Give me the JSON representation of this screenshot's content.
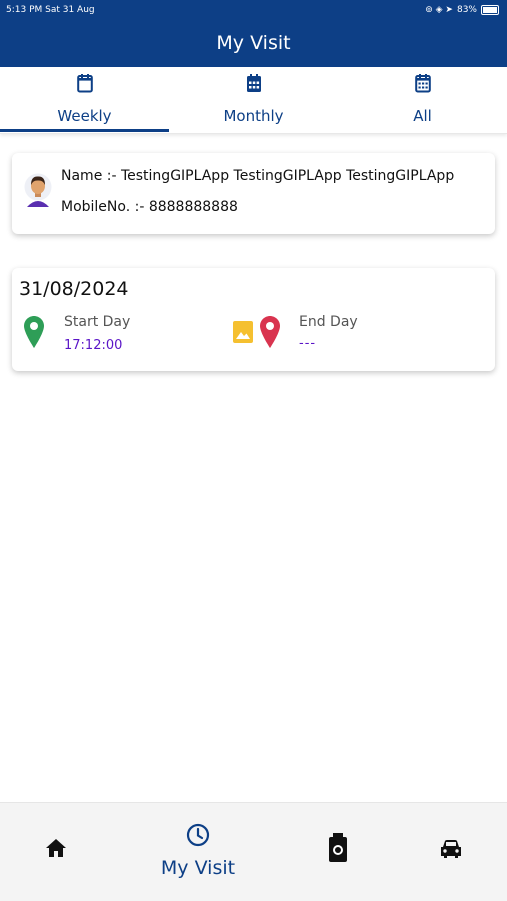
{
  "status_bar": {
    "time_date": "5:13 PM   Sat 31 Aug",
    "battery": "83%"
  },
  "header": {
    "title": "My Visit"
  },
  "tabs": [
    {
      "label": "Weekly",
      "icon": "calendar-icon",
      "selected": true
    },
    {
      "label": "Monthly",
      "icon": "calendar-month-icon",
      "selected": false
    },
    {
      "label": "All",
      "icon": "calendar-all-icon",
      "selected": false
    }
  ],
  "user": {
    "name_line": "Name :- TestingGIPLApp TestingGIPLApp TestingGIPLApp",
    "mobile_line": "MobileNo. :- 8888888888"
  },
  "visit": {
    "date": "31/08/2024",
    "start_label": "Start Day",
    "start_time": "17:12:00",
    "end_label": "End Day",
    "end_time": "---"
  },
  "bottom_nav": [
    {
      "icon": "home-icon",
      "label": ""
    },
    {
      "icon": "clock-icon",
      "label": "My Visit",
      "selected": true
    },
    {
      "icon": "fuel-icon",
      "label": ""
    },
    {
      "icon": "car-icon",
      "label": ""
    }
  ],
  "colors": {
    "primary": "#0d3f86",
    "accent_time": "#5a15c7",
    "start_pin": "#2e9e57",
    "end_pin": "#d9344f",
    "image_icon": "#f5c030"
  }
}
